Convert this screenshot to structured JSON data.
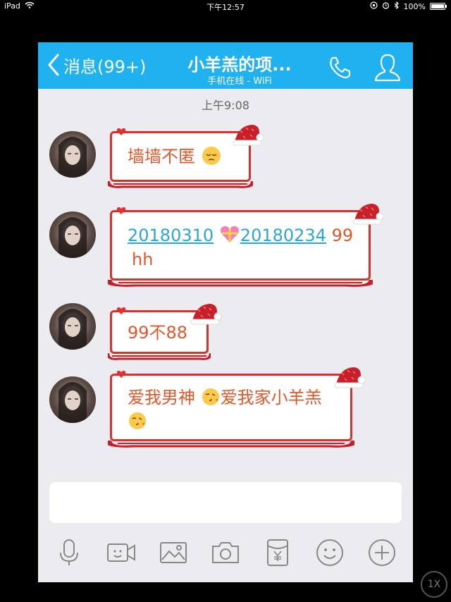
{
  "status_bar": {
    "device": "iPad",
    "time": "下午12:57",
    "battery": "100%",
    "battery_level": 1.0
  },
  "nav": {
    "back_label": "消息(99+)",
    "title": "小羊羔的项...",
    "subtitle": "手机在线 - WiFi",
    "phone_icon": "phone-icon",
    "contact_icon": "contact-icon"
  },
  "chat": {
    "timestamp": "上午9:08",
    "messages": [
      {
        "text": "墙墙不匿",
        "emoji": "pensive-face-emoji"
      },
      {
        "link1": "20180310",
        "emoji": "heart-gift-emoji",
        "link2": "20180234",
        "text_after": "99",
        "line2": "hh"
      },
      {
        "text": "99不88"
      },
      {
        "text1": "爱我男神",
        "emoji1": "kissing-face-emoji",
        "text2": "爱我家小羊羔",
        "emoji2": "kissing-face-emoji"
      }
    ]
  },
  "toolbar": {
    "items": [
      "microphone-icon",
      "video-call-icon",
      "image-icon",
      "camera-icon",
      "red-packet-icon",
      "emoji-icon",
      "add-icon"
    ]
  },
  "zoom": "1X",
  "colors": {
    "nav_bg": "#1fb1f0",
    "bubble_border": "#d8312e",
    "text_orange": "#e0572a",
    "link": "#2aa7d6",
    "chat_bg": "#ebebf0"
  }
}
